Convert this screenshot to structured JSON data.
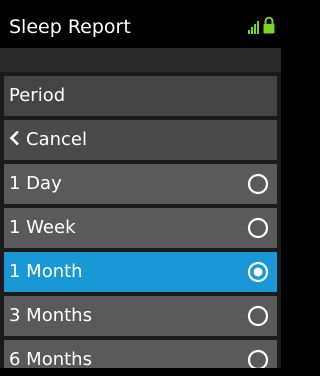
{
  "header": {
    "title": "Sleep Report",
    "signal_icon": "signal-bars-icon",
    "lock_icon": "lock-icon",
    "status_color": "#7ed321"
  },
  "menu": {
    "header_label": "Period",
    "cancel_label": "Cancel",
    "cancel_icon": "chevron-left-icon",
    "options": [
      {
        "label": "1 Day",
        "selected": false
      },
      {
        "label": "1 Week",
        "selected": false
      },
      {
        "label": "1 Month",
        "selected": true
      },
      {
        "label": "3 Months",
        "selected": false
      },
      {
        "label": "6 Months",
        "selected": false
      }
    ],
    "selected_color": "#1a98d5"
  }
}
